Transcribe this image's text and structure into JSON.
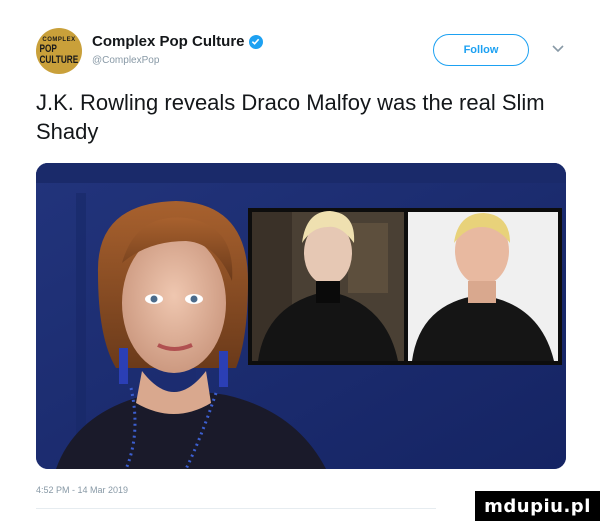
{
  "account": {
    "avatar_line1": "COMPLEX",
    "avatar_line2": "POP CULTURE",
    "display_name": "Complex Pop Culture",
    "handle": "@ComplexPop",
    "verified": true
  },
  "follow_button": {
    "label": "Follow"
  },
  "tweet": {
    "text": "J.K. Rowling reveals Draco Malfoy was the real Slim Shady",
    "timestamp": "4:52 PM - 14 Mar 2019"
  },
  "media": {
    "description_icon": "photo-collage"
  },
  "watermark": {
    "text": "mdupiu.pl"
  },
  "colors": {
    "accent": "#1da1f2",
    "text": "#14171a",
    "muted": "#8899a6",
    "avatar_bg": "#c9a03a",
    "photo_bg": "#1b2a6b"
  },
  "icons": [
    "verified-badge-icon",
    "chevron-down-icon"
  ]
}
